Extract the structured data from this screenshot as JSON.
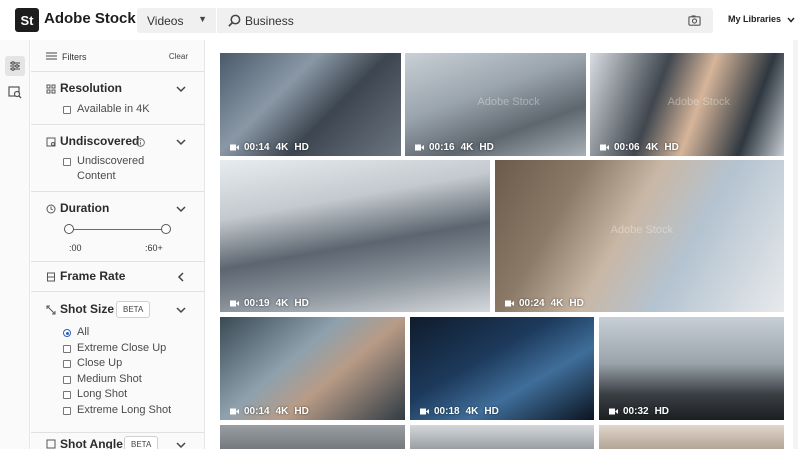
{
  "header": {
    "logo_text": "St",
    "brand": "Adobe Stock",
    "type_select": "Videos",
    "search_value": "Business",
    "libraries": "My Libraries"
  },
  "filters": {
    "title": "Filters",
    "clear": "Clear",
    "resolution": {
      "title": "Resolution",
      "option": "Available in 4K"
    },
    "undiscovered": {
      "title": "Undiscovered",
      "option": "Undiscovered Content"
    },
    "duration": {
      "title": "Duration",
      "min_label": ":00",
      "max_label": ":60+",
      "range_min_fraction": 0,
      "range_max_fraction": 1
    },
    "frame_rate": {
      "title": "Frame Rate"
    },
    "shot_size": {
      "title": "Shot Size",
      "badge": "BETA",
      "selected": "All",
      "options": [
        "All",
        "Extreme Close Up",
        "Close Up",
        "Medium Shot",
        "Long Shot",
        "Extreme Long Shot"
      ]
    },
    "shot_angle": {
      "title": "Shot Angle",
      "badge": "BETA"
    }
  },
  "results": [
    {
      "duration": "00:14",
      "res": "4K",
      "quality": "HD",
      "watermark": ""
    },
    {
      "duration": "00:16",
      "res": "4K",
      "quality": "HD",
      "watermark": "Adobe Stock"
    },
    {
      "duration": "00:06",
      "res": "4K",
      "quality": "HD",
      "watermark": "Adobe Stock"
    },
    {
      "duration": "00:19",
      "res": "4K",
      "quality": "HD",
      "watermark": ""
    },
    {
      "duration": "00:24",
      "res": "4K",
      "quality": "HD",
      "watermark": "Adobe Stock"
    },
    {
      "duration": "00:14",
      "res": "4K",
      "quality": "HD",
      "watermark": ""
    },
    {
      "duration": "00:18",
      "res": "4K",
      "quality": "HD",
      "watermark": ""
    },
    {
      "duration": "00:32",
      "res": "",
      "quality": "HD",
      "watermark": ""
    }
  ],
  "colors": {
    "accent": "#2b62c0",
    "logo_bg": "#1d1d1d",
    "search_bg": "#f0f0f0"
  }
}
